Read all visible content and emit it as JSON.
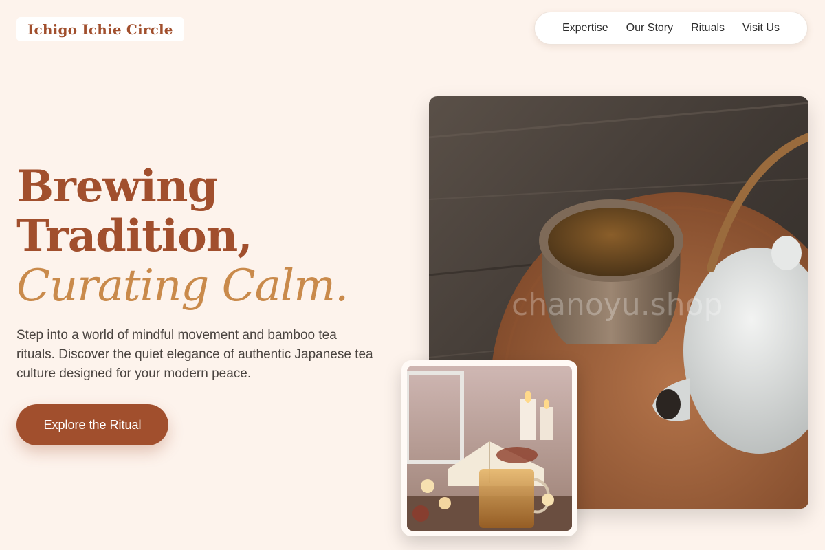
{
  "brand": {
    "name": "Ichigo Ichie Circle"
  },
  "nav": {
    "items": [
      {
        "label": "Expertise"
      },
      {
        "label": "Our Story"
      },
      {
        "label": "Rituals"
      },
      {
        "label": "Visit Us"
      }
    ]
  },
  "hero": {
    "headline_line1": "Brewing",
    "headline_line2": "Tradition,",
    "headline_accent": "Curating Calm.",
    "subtext": "Step into a world of mindful movement and bamboo tea rituals. Discover the quiet elegance of authentic Japanese tea culture designed for your modern peace.",
    "cta_label": "Explore the Ritual"
  },
  "images": {
    "main_watermark": "chanoyu.shop",
    "main_icon": "tea-cup-teapot-photo",
    "secondary_icon": "tea-candles-book-photo"
  },
  "colors": {
    "background": "#fdf3ec",
    "brand": "#a14f2d",
    "accent": "#c98a4b"
  }
}
